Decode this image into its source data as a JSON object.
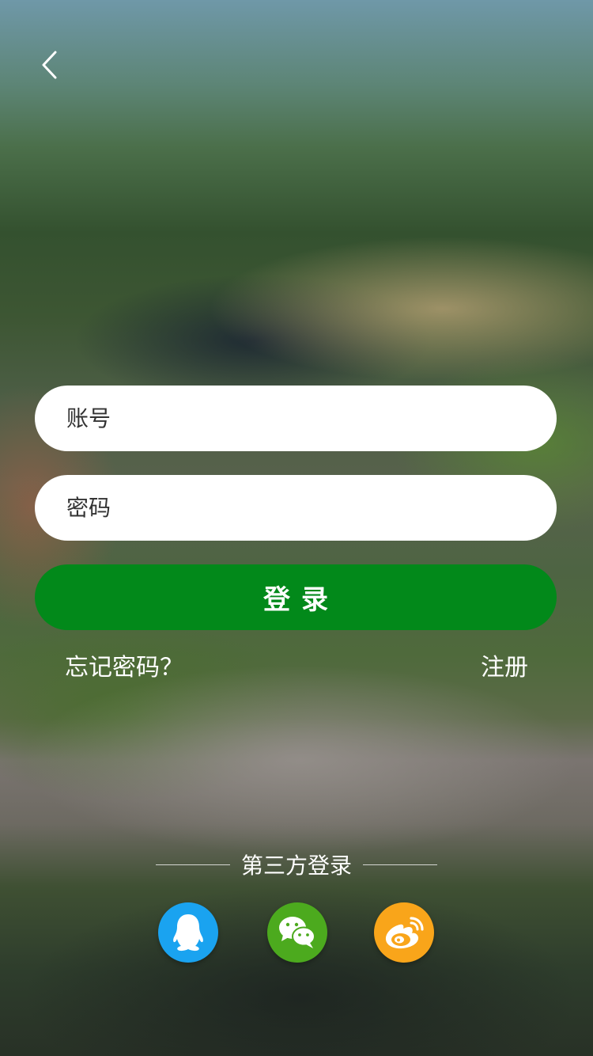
{
  "colors": {
    "primary_green": "#02891a",
    "qq_blue": "#1aa3f0",
    "wechat_green": "#4caa1e",
    "weibo_orange": "#f9a51a"
  },
  "header": {
    "back_icon": "chevron-left-icon"
  },
  "form": {
    "account_placeholder": "账号",
    "password_placeholder": "密码",
    "login_label": "登录"
  },
  "links": {
    "forgot_password": "忘记密码？",
    "register": "注册"
  },
  "third_party": {
    "title": "第三方登录",
    "providers": [
      {
        "icon": "qq-icon"
      },
      {
        "icon": "wechat-icon"
      },
      {
        "icon": "weibo-icon"
      }
    ]
  }
}
